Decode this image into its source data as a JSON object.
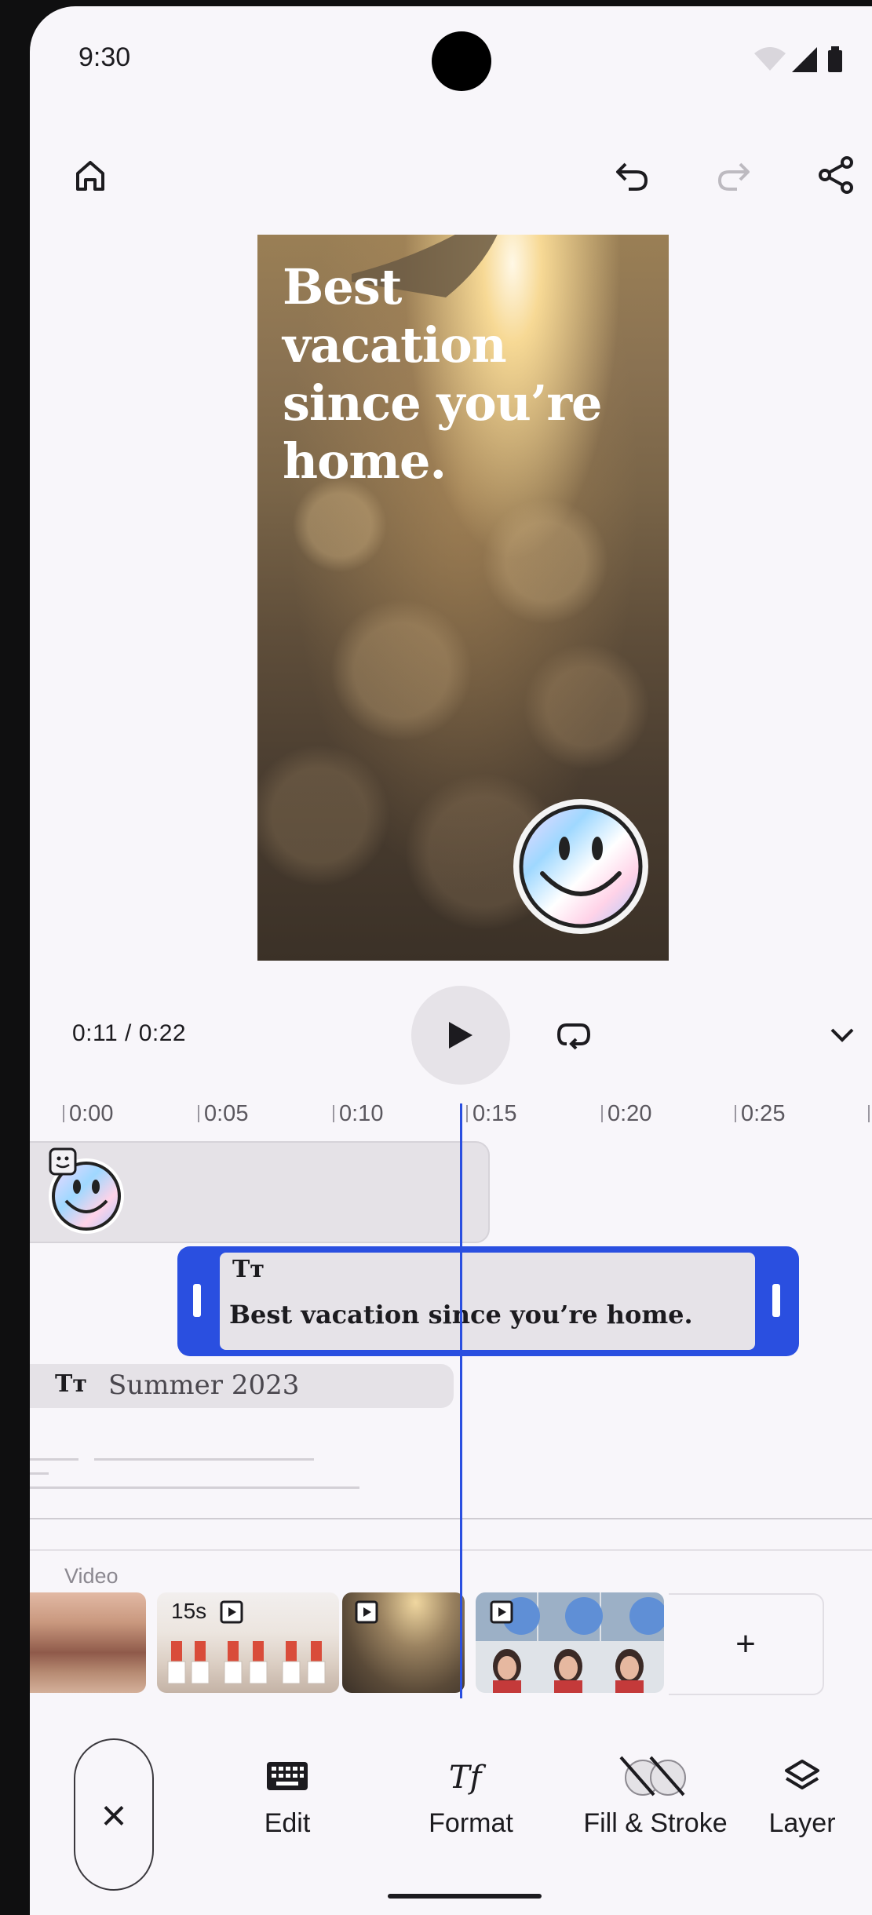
{
  "status_bar": {
    "time": "9:30"
  },
  "preview": {
    "headline": "Best vacation since you’re home."
  },
  "playback": {
    "current": "0:11",
    "separator": " / ",
    "total": "0:22"
  },
  "ruler": {
    "ticks": [
      "0:00",
      "0:05",
      "0:10",
      "0:15",
      "0:20",
      "0:25"
    ]
  },
  "tracks": {
    "selected_text": {
      "icon_label": "Tт",
      "text": "Best vacation since you’re home."
    },
    "text_track_2": {
      "icon_label": "Tт",
      "text": "Summer 2023"
    }
  },
  "video": {
    "label": "Video",
    "clips": [
      {
        "badge": ""
      },
      {
        "badge": "15s"
      },
      {
        "badge": ""
      },
      {
        "badge": ""
      }
    ],
    "add_label": "+"
  },
  "toolbar": {
    "close_label": "×",
    "tools": [
      {
        "label": "Edit"
      },
      {
        "label": "Format"
      },
      {
        "label": "Fill & Stroke"
      },
      {
        "label": "Layer"
      }
    ]
  },
  "colors": {
    "accent": "#2a4fe0",
    "surface": "#f8f6fa",
    "track": "#e5e2e7"
  }
}
